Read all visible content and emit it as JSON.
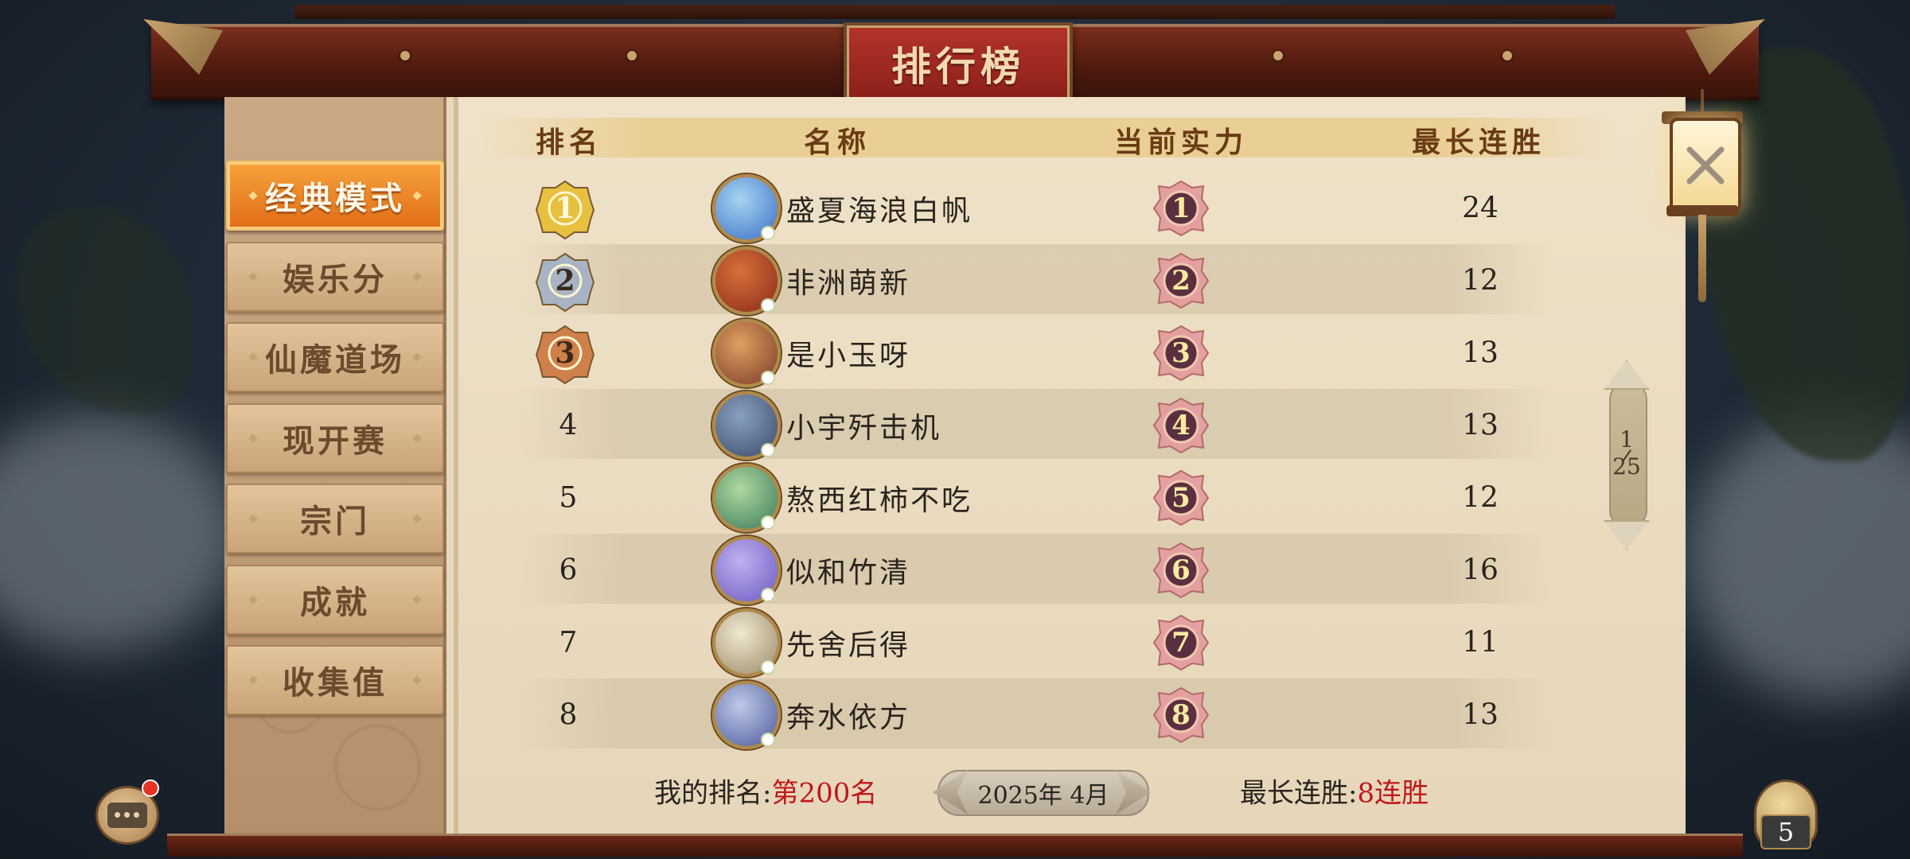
{
  "title": "排行榜",
  "sidebar": {
    "tabs": [
      {
        "label": "经典模式",
        "active": true
      },
      {
        "label": "娱乐分",
        "active": false
      },
      {
        "label": "仙魔道场",
        "active": false
      },
      {
        "label": "现开赛",
        "active": false
      },
      {
        "label": "宗门",
        "active": false
      },
      {
        "label": "成就",
        "active": false
      },
      {
        "label": "收集值",
        "active": false
      }
    ]
  },
  "table": {
    "headers": [
      "排名",
      "名称",
      "当前实力",
      "最长连胜"
    ],
    "rows": [
      {
        "rank": "1",
        "name": "盛夏海浪白帆",
        "power": "1",
        "streak": "24"
      },
      {
        "rank": "2",
        "name": "非洲萌新",
        "power": "2",
        "streak": "12"
      },
      {
        "rank": "3",
        "name": "是小玉呀",
        "power": "3",
        "streak": "13"
      },
      {
        "rank": "4",
        "name": "小宇歼击机",
        "power": "4",
        "streak": "13"
      },
      {
        "rank": "5",
        "name": "熬西红柿不吃",
        "power": "5",
        "streak": "12"
      },
      {
        "rank": "6",
        "name": "似和竹清",
        "power": "6",
        "streak": "16"
      },
      {
        "rank": "7",
        "name": "先舍后得",
        "power": "7",
        "streak": "11"
      },
      {
        "rank": "8",
        "name": "奔水依方",
        "power": "8",
        "streak": "13"
      }
    ]
  },
  "footer": {
    "my_rank_label": "我的排名:",
    "my_rank_value": "第200名",
    "date": "2025年 4月",
    "best_streak_label": "最长连胜:",
    "best_streak_value": "8连胜"
  },
  "pager": {
    "current": "1",
    "total": "25"
  },
  "pouch_count": "5",
  "colors": {
    "active_tab": "#e06d16",
    "highlight_red": "#c0181a",
    "gold_medal": "#e8c040",
    "silver_medal": "#a8b4c4",
    "bronze_medal": "#d0804a",
    "header_text": "#6a3b14"
  }
}
